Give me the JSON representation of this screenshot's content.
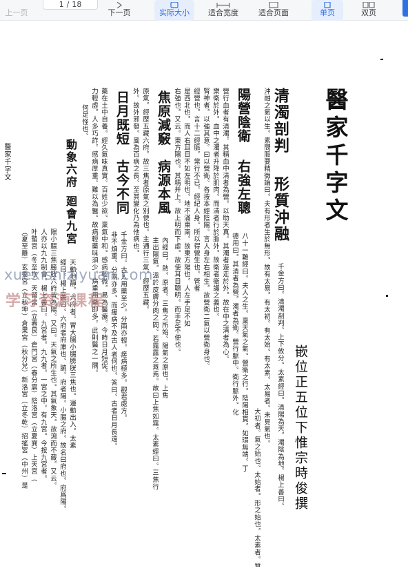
{
  "toolbar": {
    "prev_page": "上一页",
    "page_current": "1",
    "page_sep": "/",
    "page_total": "18",
    "next_page": "下一页",
    "actual_size": "实际大小",
    "fit_width": "适合宽度",
    "fit_page": "适合页面",
    "single_page": "单页",
    "double_page": "双页"
  },
  "document": {
    "title": "醫家千字文",
    "byline": "嵌位正五位下惟宗時俊撰",
    "col_1_heading": "清濁剖判",
    "col_1_heading_b": "形質沖融",
    "col_1_text": "千金方曰。清濁剖判。上下攸分。太素經曰。清陽為天。濁陰為地。楊上善曰。",
    "col_2_text": "沖融之氣以生。素問脈要精微論曰。夫有形者生於無形。故有太易。有太初。有太始。有太素。太易者。未見氣也。",
    "col_3_text": "大初者。氣之始也。太始者。形之始也。太素者。質之始也。",
    "col_4_heading": "陽營陰衛",
    "col_4_heading_b": "右強左聰",
    "col_4_text": "八十一難經曰。夫人之生。稟天氣之氣。營衛之行。陰陽相貫。如環無端。丁",
    "col_5_text": "德用曰。其清者為營。濁者為衛。營行脈中。衛行脈外。化",
    "col_6_text": "營行血者有清濁。其精血中清者為營。以助天真。其濁者遊走於外。故在中之清者為心。",
    "col_7_text": "樂衛於外。血中之濁者升降於肌肉。而清者行於脈外。故衛者衛護之義也。",
    "col_8_text": "腎神者。以強其意。曰以營衛。各按本經陰陽。言人身左右相生。故營衛二氣以營衛身也。",
    "col_9_text": "經營也。言十二經脈。常行不已。經紀人身。所以得營生也。管者",
    "col_10_text": "是西北也。而人右耳目不如左明也。地不滿東南。故東方陽也。人左手足不如",
    "col_11_text": "右強也。又云。東方陽也。其精并上。故上明而下虛。故使耳目聰明。而手足不便也。",
    "col_12_heading": "焦原減竅",
    "col_12_heading_b": "病源本風",
    "col_12_text": "內經曰。熱。原者。三焦之所始。陽氣之原也。上焦",
    "col_13_text": "主出陽氣。溫於皮膚分肉之間。若霧露之溉焉。故曰上焦如霧。太素經曰。三焦行",
    "col_14_text": "原氣。經歷五藏六府。故三焦者原氣之別使也。主通行三氣。經歷五藏。",
    "col_15_text": "外。故外邪發。風為百病之長。至其變化乃為他病也。",
    "col_16_heading": "日月既短",
    "col_16_heading_b": "古今不同",
    "col_16_text": "千金方曰。古人用藥至少。分兩亦輕。瘥病極多。觀君處方。",
    "col_17_text": "非不煩重。分兩亦多。而瘥病不及古人者何也。答曰。古者日月長遠。",
    "col_18_text": "藥在土中自養。經久氣味真實。百姓少欲。稟氣中和。感病輕微。易為醫療。今時日月短促。",
    "col_19_text": "力輕虛。人多巧詐。感病厚重。難以為醫。故病輕藥味須少。病重用藥即多。此則醫之一隅。",
    "col_20_text": "何足怪也。",
    "col_21_heading": "動象六府",
    "col_21_heading_b": "廻會九宮",
    "col_21_text": "天動地靜。六府者。胃大腸小腸膀胱三焦也。運動出入。太素",
    "col_22_text": "經曰。楊上善曰。六府者府庫也。腑。府者陽。小腸之府。故名曰府也。府爲陽。",
    "col_23_text": "陽小腸三焦膀胱六府皆為陽。又曰。天氣之所生也。其氣象天。故瀉而不藏。又云。",
    "col_24_text": "人亦以九九制會。楊上善曰。九宮者。九九者。一宮之中。有九宮。今按九宮者。",
    "col_25_text": "叶蟄宮（冬至坎）天留宮（立春艮）倉門宮（春分震）陰洛宮（立夏巽）上天宮（",
    "col_26_text": "（夏至離）玄委宮（立秋坤）倉果宮（秋分兌）新洛宮（立冬乾）招搖宮（中州）是",
    "col_27_text": "醫家千字文"
  }
}
